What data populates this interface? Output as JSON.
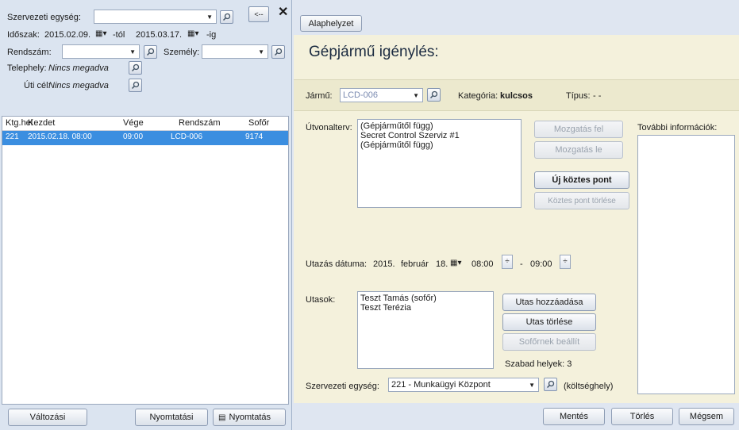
{
  "left": {
    "org_unit_label": "Szervezeti egység:",
    "org_unit_value": "",
    "period_label": "Időszak:",
    "date_from": "2015.02.09.",
    "from_suffix": "-tól",
    "date_to": "2015.03.17.",
    "to_suffix": "-ig",
    "plate_label": "Rendszám:",
    "plate_value": "",
    "person_label": "Személy:",
    "person_value": "",
    "site_label": "Telephely:",
    "site_value": "Nincs megadva",
    "destination_label": "Úti cél:",
    "destination_value": "Nincs megadva",
    "columns": [
      "Ktg.hel",
      "Kezdet",
      "Vége",
      "Rendszám",
      "Sofőr"
    ],
    "rows": [
      [
        "221",
        "2015.02.18. 08:00",
        "09:00",
        "LCD-006",
        "9174"
      ]
    ],
    "btn_changes": "Változási",
    "btn_print_list": "Nyomtatási",
    "btn_print": "Nyomtatás"
  },
  "right": {
    "reset_button": "Alaphelyzet",
    "title": "Gépjármű igénylés:",
    "vehicle_label": "Jármű:",
    "vehicle_value": "LCD-006",
    "category_label": "Kategória:",
    "category_value": "kulcsos",
    "type_label": "Típus:",
    "type_value": "- -",
    "route_label": "Útvonalterv:",
    "route_items": [
      "(Gépjárműtől függ)",
      "Secret Control Szerviz #1",
      "(Gépjárműtől függ)"
    ],
    "btn_move_up": "Mozgatás fel",
    "btn_move_down": "Mozgatás le",
    "btn_new_point": "Új köztes pont",
    "btn_delete_point": "Köztes pont törlése",
    "more_info_label": "További információk:",
    "travel_date_label": "Utazás dátuma:",
    "travel_year": "2015.",
    "travel_month": "február",
    "travel_day": "18.",
    "time_from": "08:00",
    "time_sep": "-",
    "time_to": "09:00",
    "passengers_label": "Utasok:",
    "passengers": [
      "Teszt Tamás (sofőr)",
      "Teszt Terézia"
    ],
    "btn_add_passenger": "Utas hozzáadása",
    "btn_remove_passenger": "Utas törlése",
    "btn_set_driver": "Sofőrnek beállít",
    "free_seats": "Szabad helyek: 3",
    "org_label": "Szervezeti egység:",
    "org_value": "221 - Munkaügyi Központ",
    "cost_center_note": "(költséghely)",
    "btn_save": "Mentés",
    "btn_delete": "Törlés",
    "btn_cancel": "Mégsem"
  },
  "icons": {
    "search": "search-icon",
    "calendar": "calendar-icon",
    "close": "close-icon",
    "back": "back-arrow-icon",
    "printer": "printer-icon"
  }
}
